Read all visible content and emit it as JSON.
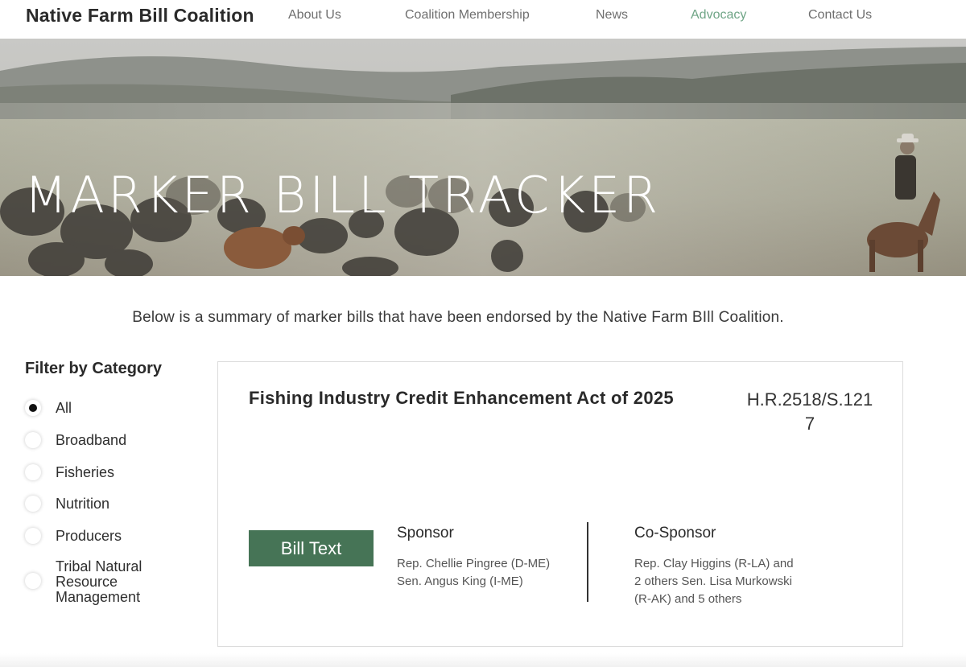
{
  "header": {
    "brand": "Native Farm Bill Coalition",
    "nav": [
      {
        "label": "About Us"
      },
      {
        "label": "Coalition Membership"
      },
      {
        "label": "News"
      },
      {
        "label": "Advocacy",
        "active": true
      },
      {
        "label": "Contact Us"
      }
    ],
    "active_color": "#6fa586"
  },
  "hero": {
    "title": "MARKER BILL TRACKER"
  },
  "intro": "Below is a summary of marker bills that have been endorsed by the Native Farm BIll Coalition.",
  "filter": {
    "title": "Filter by Category",
    "options": [
      {
        "label": "All",
        "checked": true
      },
      {
        "label": "Broadband",
        "checked": false
      },
      {
        "label": "Fisheries",
        "checked": false
      },
      {
        "label": "Nutrition",
        "checked": false
      },
      {
        "label": "Producers",
        "checked": false
      },
      {
        "label": "Tribal Natural Resource Management",
        "checked": false
      }
    ]
  },
  "bill": {
    "title": "Fishing Industry Credit Enhancement Act of 2025",
    "number": "H.R.2518/S.1217",
    "button_label": "Bill Text",
    "button_color": "#467456",
    "sponsor_heading": "Sponsor",
    "sponsor_text": "Rep. Chellie Pingree (D-ME) Sen. Angus King (I-ME)",
    "cosponsor_heading": "Co-Sponsor",
    "cosponsor_text": "Rep. Clay Higgins (R-LA) and 2 others Sen. Lisa Murkowski (R-AK) and 5 others"
  }
}
